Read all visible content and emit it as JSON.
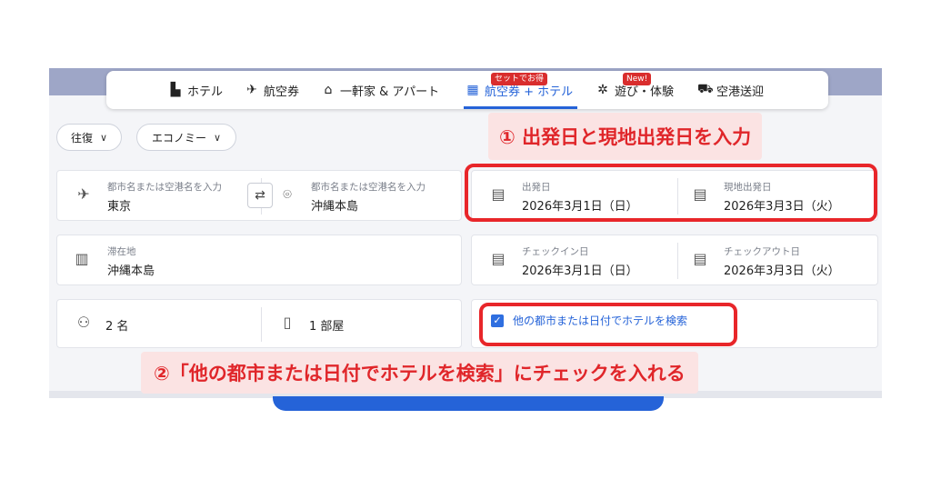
{
  "tabs": [
    {
      "icon": "hotel-icon",
      "glyph": "▙",
      "label": "ホテル"
    },
    {
      "icon": "airplane-icon",
      "glyph": "✈",
      "label": "航空券"
    },
    {
      "icon": "house-icon",
      "glyph": "⌂",
      "label": "一軒家 & アパート"
    },
    {
      "icon": "flight-hotel-icon",
      "glyph": "▦",
      "label": "航空券 + ホテル",
      "badge": "セットでお得",
      "active": true
    },
    {
      "icon": "ferris-wheel-icon",
      "glyph": "✲",
      "label": "遊び・体験",
      "badge": "New!"
    },
    {
      "icon": "car-icon",
      "glyph": "⛟",
      "label": "空港送迎"
    }
  ],
  "filters": {
    "trip_type": "往復",
    "cabin_class": "エコノミー"
  },
  "origin": {
    "label": "都市名または空港名を入力",
    "value": "東京"
  },
  "destination": {
    "label": "都市名または空港名を入力",
    "value": "沖縄本島"
  },
  "departure": {
    "label": "出発日",
    "value": "2026年3月1日（日）"
  },
  "return_flight": {
    "label": "現地出発日",
    "value": "2026年3月3日（火）"
  },
  "stay": {
    "label": "滞在地",
    "value": "沖縄本島"
  },
  "checkin": {
    "label": "チェックイン日",
    "value": "2026年3月1日（日）"
  },
  "checkout": {
    "label": "チェックアウト日",
    "value": "2026年3月3日（火）"
  },
  "guests": {
    "value": "2 名"
  },
  "rooms": {
    "value": "1 部屋"
  },
  "other_city_checkbox": {
    "label": "他の都市または日付でホテルを検索",
    "checked": true
  },
  "annotations": {
    "step1": "① 出発日と現地出発日を入力",
    "step2": "②「他の都市または日付でホテルを検索」にチェックを入れる"
  },
  "colors": {
    "accent": "#2563d8",
    "highlight": "#e8262a",
    "callout_bg": "#fbe3e3",
    "badge": "#d92d2d"
  }
}
